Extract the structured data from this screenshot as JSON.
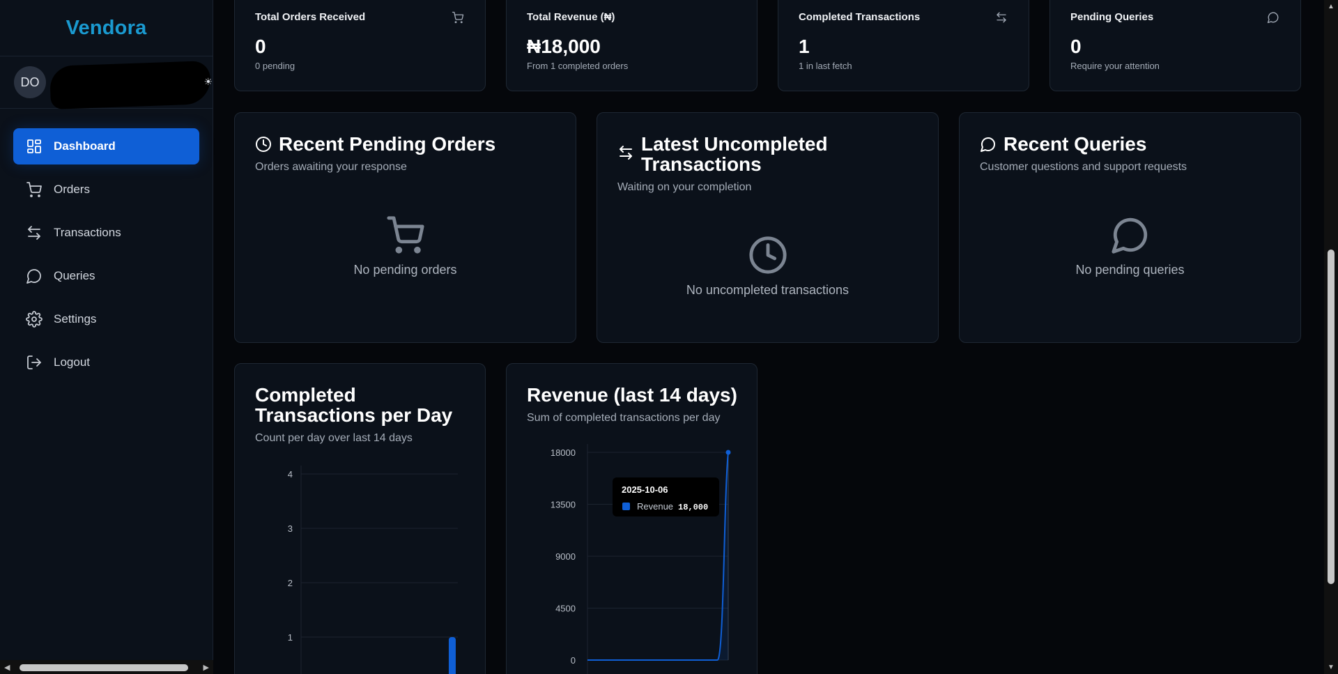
{
  "app": {
    "brand": "Vendora"
  },
  "user": {
    "initials": "DO",
    "theme_icon": "sun-icon"
  },
  "sidebar": {
    "items": [
      {
        "label": "Dashboard",
        "icon": "dashboard-icon",
        "active": true
      },
      {
        "label": "Orders",
        "icon": "cart-icon"
      },
      {
        "label": "Transactions",
        "icon": "arrows-icon"
      },
      {
        "label": "Queries",
        "icon": "chat-icon"
      },
      {
        "label": "Settings",
        "icon": "gear-icon"
      },
      {
        "label": "Logout",
        "icon": "logout-icon"
      }
    ]
  },
  "stats": [
    {
      "title": "Total Orders Received",
      "value": "0",
      "sub": "0 pending",
      "icon": "cart-icon"
    },
    {
      "title": "Total Revenue (₦)",
      "value": "₦18,000",
      "sub": "From 1 completed orders"
    },
    {
      "title": "Completed Transactions",
      "value": "1",
      "sub": "1 in last fetch",
      "icon": "arrows-icon"
    },
    {
      "title": "Pending Queries",
      "value": "0",
      "sub": "Require your attention",
      "icon": "chat-icon"
    }
  ],
  "panels": [
    {
      "title": "Recent Pending Orders",
      "sub": "Orders awaiting your response",
      "empty_text": "No pending orders",
      "icon": "clock-icon",
      "empty_icon": "cart-icon"
    },
    {
      "title": "Latest Uncompleted Transactions",
      "sub": "Waiting on your completion",
      "empty_text": "No uncompleted transactions",
      "icon": "arrows-icon",
      "empty_icon": "clock-icon"
    },
    {
      "title": "Recent Queries",
      "sub": "Customer questions and support requests",
      "empty_text": "No pending queries",
      "icon": "chat-icon",
      "empty_icon": "chat-icon"
    }
  ],
  "charts": [
    {
      "title": "Completed Transactions per Day",
      "sub": "Count per day over last 14 days"
    },
    {
      "title": "Revenue (last 14 days)",
      "sub": "Sum of completed transactions per day"
    }
  ],
  "tooltip": {
    "date": "2025-10-06",
    "series": "Revenue",
    "value": "18,000"
  },
  "chart_data": [
    {
      "type": "bar",
      "title": "Completed Transactions per Day",
      "subtitle": "Count per day over last 14 days",
      "yticks": [
        "4",
        "3",
        "2",
        "1"
      ],
      "ylim": [
        0,
        4
      ],
      "series": [
        {
          "name": "",
          "values": [
            0,
            0,
            0,
            0,
            0,
            0,
            0,
            0,
            0,
            0,
            0,
            0,
            0,
            1
          ]
        }
      ],
      "grid": true,
      "color": "#0f5fd6"
    },
    {
      "type": "area",
      "title": "Revenue (last 14 days)",
      "subtitle": "Sum of completed transactions per day",
      "yticks": [
        "18000",
        "13500",
        "9000",
        "4500",
        "0"
      ],
      "ylim": [
        0,
        18000
      ],
      "series": [
        {
          "name": "Revenue",
          "values": [
            0,
            0,
            0,
            0,
            0,
            0,
            0,
            0,
            0,
            0,
            0,
            0,
            0,
            18000
          ]
        }
      ],
      "grid": true,
      "color": "#0f5fd6"
    }
  ]
}
